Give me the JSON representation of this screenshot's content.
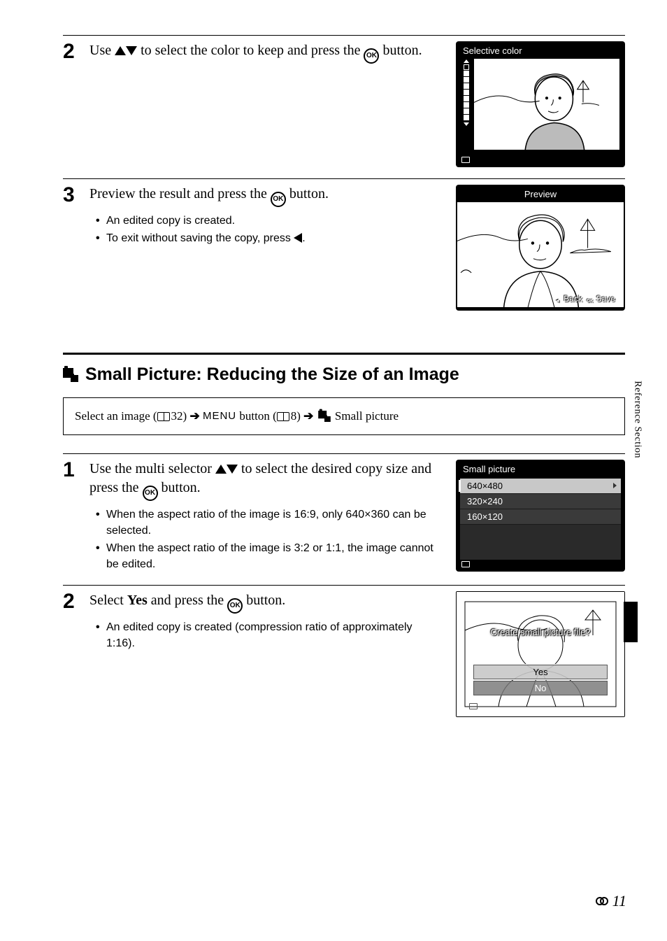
{
  "sidebar_label": "Reference Section",
  "page_number": "11",
  "step2_upper": {
    "text_a": "Use ",
    "text_b": " to select the color to keep and press the ",
    "text_c": " button.",
    "screen_title": "Selective color"
  },
  "step3": {
    "text_a": "Preview the result and press the ",
    "text_b": " button.",
    "bullet1": "An edited copy is created.",
    "bullet2_a": "To exit without saving the copy, press ",
    "bullet2_b": ".",
    "screen_title": "Preview",
    "back_label": "Back",
    "save_label": "Save"
  },
  "heading": "Small Picture: Reducing the Size of an Image",
  "navbox": {
    "a": "Select an image (",
    "ref1": "32",
    "b": ") ",
    "c": " button (",
    "ref2": "8",
    "d": ") ",
    "e": " Small picture"
  },
  "step1_lower": {
    "text_a": "Use the multi selector ",
    "text_b": " to select the desired copy size and press the ",
    "text_c": " button.",
    "bullet1_a": "When the aspect ratio of the image is 16:9, only ",
    "bullet1_bold": "640×360",
    "bullet1_b": " can be selected.",
    "bullet2": "When the aspect ratio of the image is 3:2 or 1:1, the image cannot be edited.",
    "menu_title": "Small picture",
    "opt1": "640×480",
    "opt2": "320×240",
    "opt3": "160×120"
  },
  "step2_lower": {
    "text_a": "Select ",
    "text_bold": "Yes",
    "text_b": " and press the ",
    "text_c": " button.",
    "bullet1": "An edited copy is created (compression ratio of approximately 1:16).",
    "dialog_q": "Create small picture file?",
    "yes": "Yes",
    "no": "No"
  }
}
